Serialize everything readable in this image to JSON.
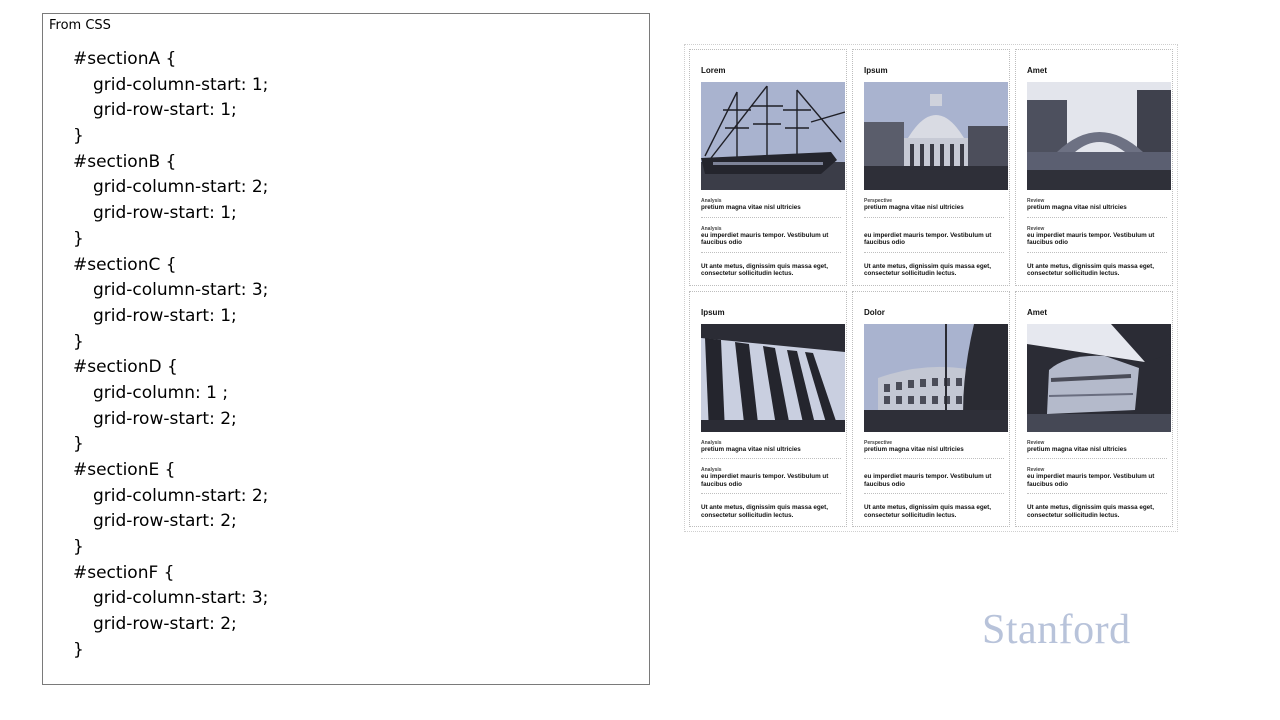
{
  "code_panel": {
    "title": "From CSS",
    "lines": [
      {
        "text": "#sectionA {",
        "indent": 0
      },
      {
        "text": "grid-column-start: 1;",
        "indent": 1
      },
      {
        "text": "grid-row-start: 1;",
        "indent": 1
      },
      {
        "text": "}",
        "indent": 0
      },
      {
        "text": "#sectionB {",
        "indent": 0
      },
      {
        "text": "grid-column-start: 2;",
        "indent": 1
      },
      {
        "text": "grid-row-start: 1;",
        "indent": 1
      },
      {
        "text": "}",
        "indent": 0
      },
      {
        "text": "#sectionC {",
        "indent": 0
      },
      {
        "text": "grid-column-start: 3;",
        "indent": 1
      },
      {
        "text": "grid-row-start: 1;",
        "indent": 1
      },
      {
        "text": "}",
        "indent": 0
      },
      {
        "text": "#sectionD {",
        "indent": 0
      },
      {
        "text": "grid-column: 1 ;",
        "indent": 1
      },
      {
        "text": "grid-row-start: 2;",
        "indent": 1
      },
      {
        "text": "}",
        "indent": 0
      },
      {
        "text": "#sectionE {",
        "indent": 0
      },
      {
        "text": "grid-column-start: 2;",
        "indent": 1
      },
      {
        "text": "grid-row-start: 2;",
        "indent": 1
      },
      {
        "text": "}",
        "indent": 0
      },
      {
        "text": "#sectionF {",
        "indent": 0
      },
      {
        "text": "grid-column-start: 3;",
        "indent": 1
      },
      {
        "text": "grid-row-start: 2;",
        "indent": 1
      },
      {
        "text": "}",
        "indent": 0
      }
    ]
  },
  "cards": [
    {
      "title": "Lorem",
      "photo": "ship-photo",
      "label1": "Analysis",
      "text1": "pretium magna vitae nisl ultricies",
      "label2": "Analysis",
      "text2": "eu imperdiet mauris tempor. Vestibulum ut faucibus odio",
      "text3": "Ut ante metus, dignissim quis massa eget, consectetur sollicitudin lectus."
    },
    {
      "title": "Ipsum",
      "photo": "domed-church-photo",
      "label1": "Perspective",
      "text1": "pretium magna vitae nisl ultricies",
      "label2": "",
      "text2": "eu imperdiet mauris tempor. Vestibulum ut faucibus odio",
      "text3": "Ut ante metus, dignissim quis massa eget, consectetur sollicitudin lectus."
    },
    {
      "title": "Amet",
      "photo": "bridge-photo",
      "label1": "Review",
      "text1": "pretium magna vitae nisl ultricies",
      "label2": "Review",
      "text2": "eu imperdiet mauris tempor. Vestibulum ut faucibus odio",
      "text3": "Ut ante metus, dignissim quis massa eget, consectetur sollicitudin lectus."
    },
    {
      "title": "Ipsum",
      "photo": "columns-photo",
      "label1": "Analysis",
      "text1": "pretium magna vitae nisl ultricies",
      "label2": "Analysis",
      "text2": "eu imperdiet mauris tempor. Vestibulum ut faucibus odio",
      "text3": "Ut ante metus, dignissim quis massa eget, consectetur sollicitudin lectus."
    },
    {
      "title": "Dolor",
      "photo": "colosseum-photo",
      "label1": "Perspective",
      "text1": "pretium magna vitae nisl ultricies",
      "label2": "",
      "text2": "eu imperdiet mauris tempor. Vestibulum ut faucibus odio",
      "text3": "Ut ante metus, dignissim quis massa eget, consectetur sollicitudin lectus."
    },
    {
      "title": "Amet",
      "photo": "train-photo",
      "label1": "Review",
      "text1": "pretium magna vitae nisl ultricies",
      "label2": "Review",
      "text2": "eu imperdiet mauris tempor. Vestibulum ut faucibus odio",
      "text3": "Ut ante metus, dignissim quis massa eget, consectetur sollicitudin lectus."
    }
  ],
  "logo": "Stanford",
  "colors": {
    "photo_dark": "#2b2b33",
    "photo_sky": "#a9b3cf",
    "logo": "#b8c3da"
  }
}
